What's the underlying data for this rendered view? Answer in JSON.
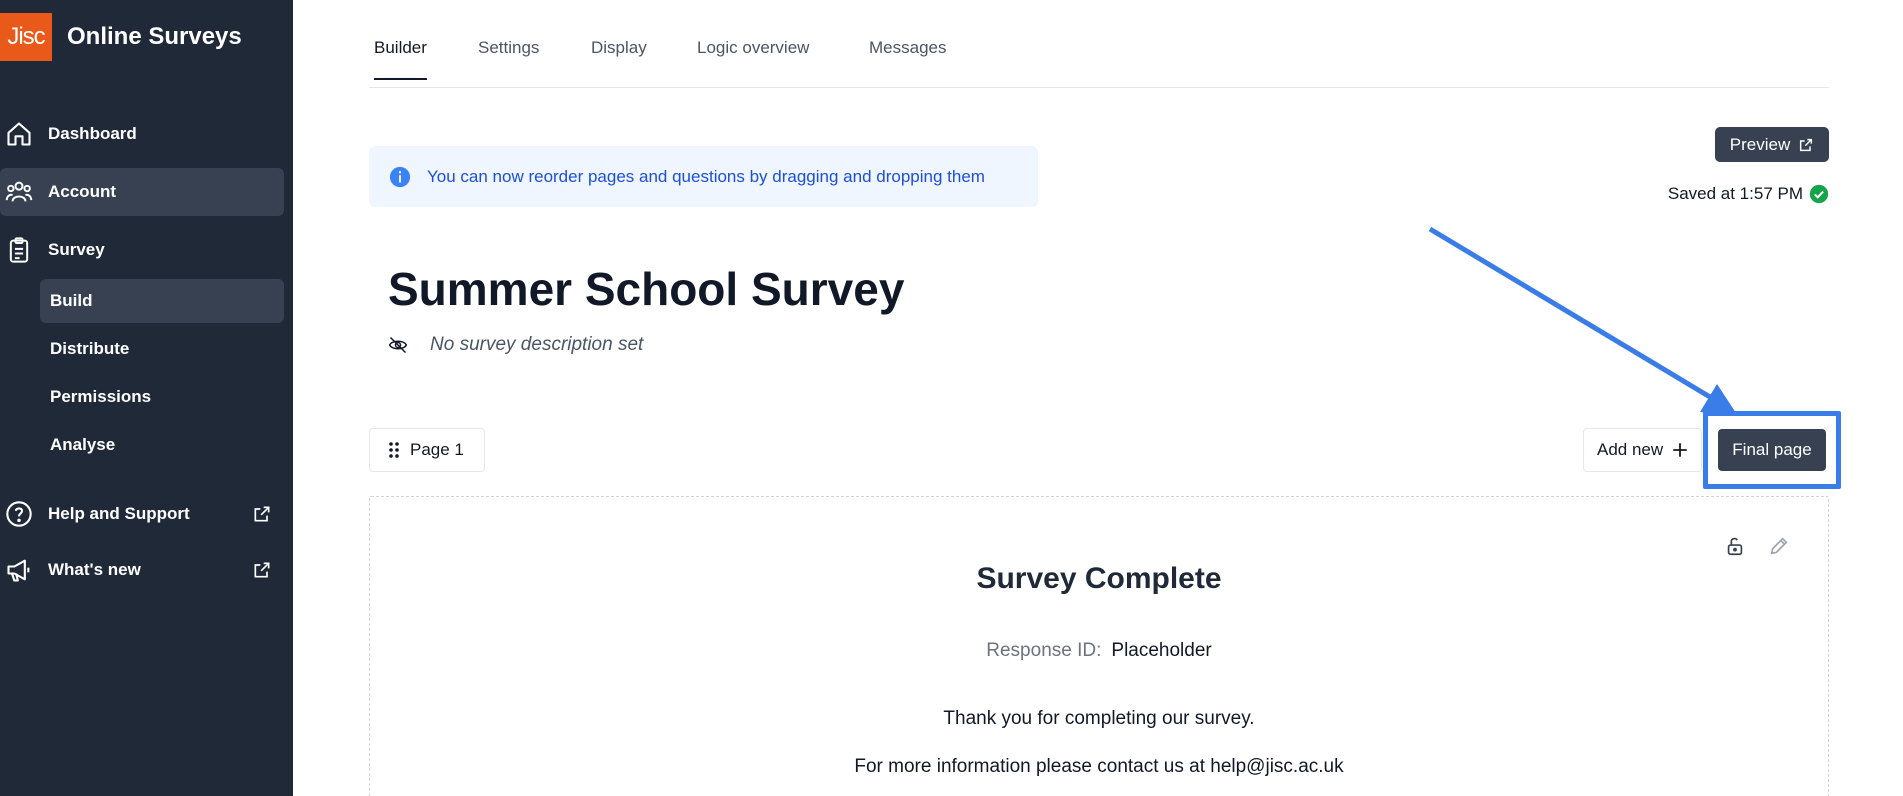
{
  "brand": {
    "logo_text": "Jisc",
    "app_name": "Online Surveys",
    "logo_color": "#e8591a"
  },
  "sidebar": {
    "items": [
      {
        "label": "Dashboard",
        "icon": "home-icon"
      },
      {
        "label": "Account",
        "icon": "users-icon"
      },
      {
        "label": "Survey",
        "icon": "clipboard-icon"
      }
    ],
    "sub_items": [
      {
        "label": "Build"
      },
      {
        "label": "Distribute"
      },
      {
        "label": "Permissions"
      },
      {
        "label": "Analyse"
      }
    ],
    "help": {
      "label": "Help and Support",
      "icon": "help-circle-icon"
    },
    "whats_new": {
      "label": "What's new",
      "icon": "megaphone-icon"
    }
  },
  "tabs": [
    {
      "label": "Builder",
      "active": true
    },
    {
      "label": "Settings"
    },
    {
      "label": "Display"
    },
    {
      "label": "Logic overview"
    },
    {
      "label": "Messages"
    }
  ],
  "banner": {
    "message": "You can now reorder pages and questions by dragging and dropping them",
    "icon": "info-icon"
  },
  "toolbar": {
    "preview_label": "Preview",
    "saved_text": "Saved at 1:57 PM"
  },
  "survey": {
    "title": "Summer School Survey",
    "description_placeholder": "No survey description set"
  },
  "pages": {
    "page_label": "Page 1",
    "add_new_label": "Add new",
    "final_page_label": "Final page"
  },
  "final_page": {
    "title": "Survey Complete",
    "response_label": "Response ID:",
    "response_value": "Placeholder",
    "thanks": "Thank you for completing our survey.",
    "contact": "For more information please contact us at help@jisc.ac.uk"
  },
  "colors": {
    "sidebar_bg": "#1f2937",
    "accent_dark": "#374151",
    "annotation": "#3b7de8",
    "info_text": "#1d4ed8"
  }
}
